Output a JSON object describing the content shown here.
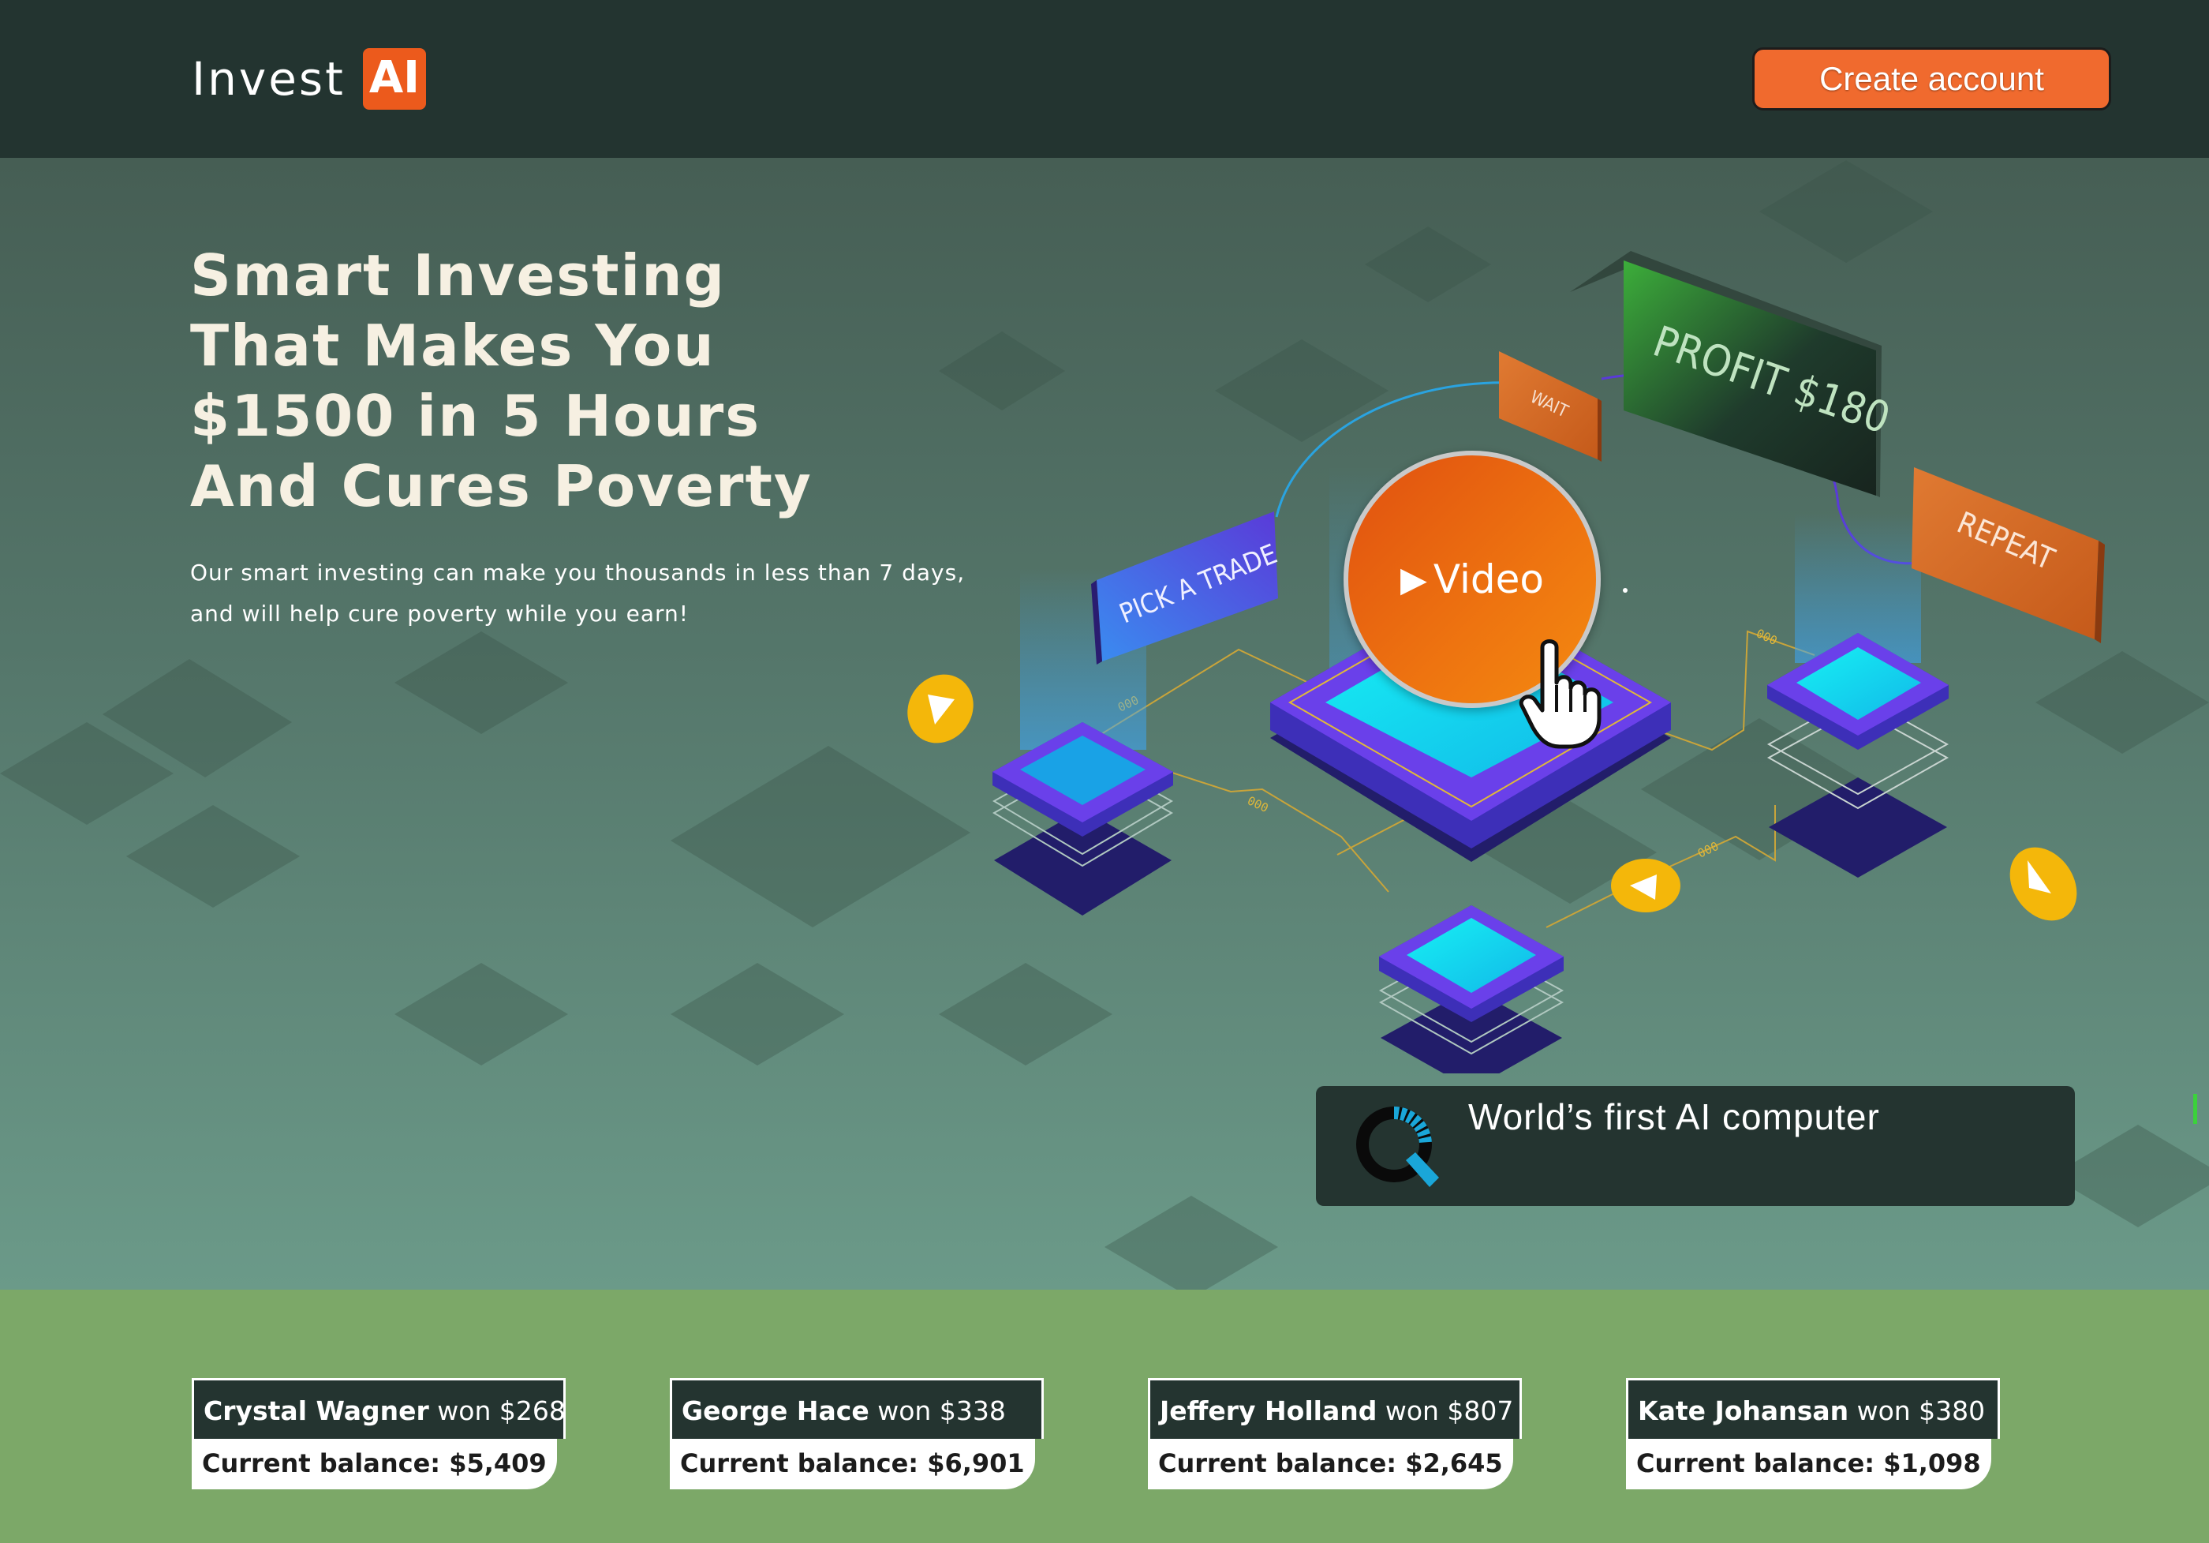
{
  "header": {
    "logo_text": "Invest",
    "logo_badge": "AI",
    "cta_label": "Create account"
  },
  "hero": {
    "headline": [
      "Smart Investing",
      "That Makes You",
      "$1500 in 5 Hours",
      "And Cures Poverty"
    ],
    "subtext": [
      "Our smart investing can make you thousands in less than 7 days,",
      "and will help cure poverty while you earn!"
    ],
    "video_label": "Video",
    "illustration_labels": {
      "pick": "PICK A TRADE",
      "wait": "WAIT",
      "profit": "PROFIT $180",
      "repeat": "REPEAT",
      "link": "000"
    },
    "ai_card_text": "World’s first AI computer"
  },
  "winners": [
    {
      "name": "Crystal Wagner",
      "won_text": "won $268",
      "balance": "Current balance: $5,409"
    },
    {
      "name": "George Hace",
      "won_text": "won $338",
      "balance": "Current balance: $6,901"
    },
    {
      "name": "Jeffery Holland",
      "won_text": "won $807",
      "balance": "Current balance: $2,645"
    },
    {
      "name": "Kate Johansan",
      "won_text": "won $380",
      "balance": "Current balance: $1,098"
    }
  ],
  "colors": {
    "header_bg": "#233430",
    "accent_orange": "#ec5a1c",
    "hero_top": "#465e54",
    "hero_bottom": "#6b9a89",
    "winners_bg": "#7ca868",
    "cyan": "#18e6f0",
    "purple": "#5a2ed8"
  }
}
